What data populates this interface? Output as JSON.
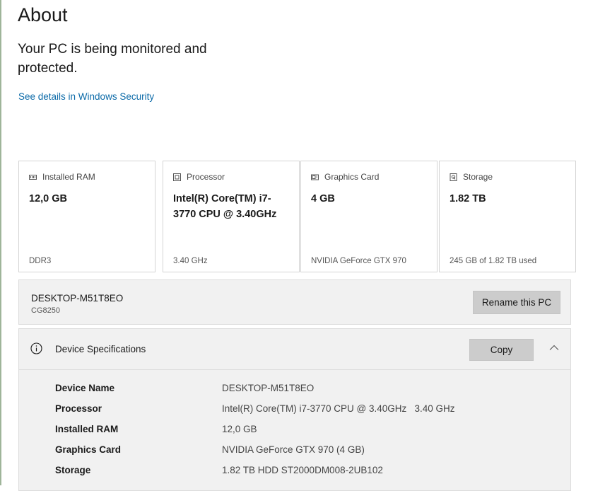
{
  "page": {
    "title": "About"
  },
  "security": {
    "message": "Your PC is being monitored and protected.",
    "link": "See details in Windows Security"
  },
  "cards": [
    {
      "icon": "ram-icon",
      "label": "Installed RAM",
      "value": "12,0 GB",
      "sub": "DDR3"
    },
    {
      "icon": "processor-icon",
      "label": "Processor",
      "value": "Intel(R) Core(TM) i7-3770 CPU @ 3.40GHz",
      "sub": "3.40 GHz"
    },
    {
      "icon": "graphics-card-icon",
      "label": "Graphics Card",
      "value": "4 GB",
      "sub": "NVIDIA GeForce GTX 970"
    },
    {
      "icon": "storage-icon",
      "label": "Storage",
      "value": "1.82 TB",
      "sub": "245 GB of 1.82 TB used"
    }
  ],
  "pc": {
    "name": "DESKTOP-M51T8EO",
    "model": "CG8250",
    "rename_label": "Rename this PC"
  },
  "specs": {
    "title": "Device Specifications",
    "copy_label": "Copy",
    "rows": [
      {
        "label": "Device Name",
        "value": "DESKTOP-M51T8EO"
      },
      {
        "label": "Processor",
        "value": "Intel(R) Core(TM) i7-3770 CPU @ 3.40GHz   3.40 GHz"
      },
      {
        "label": "Installed RAM",
        "value": "12,0 GB"
      },
      {
        "label": "Graphics Card",
        "value": "NVIDIA GeForce GTX 970 (4 GB)"
      },
      {
        "label": "Storage",
        "value": "1.82 TB HDD ST2000DM008-2UB102"
      }
    ]
  },
  "colors": {
    "link": "#0b6aa8",
    "panel_bg": "#f1f1f1",
    "button_bg": "#cccccc"
  }
}
